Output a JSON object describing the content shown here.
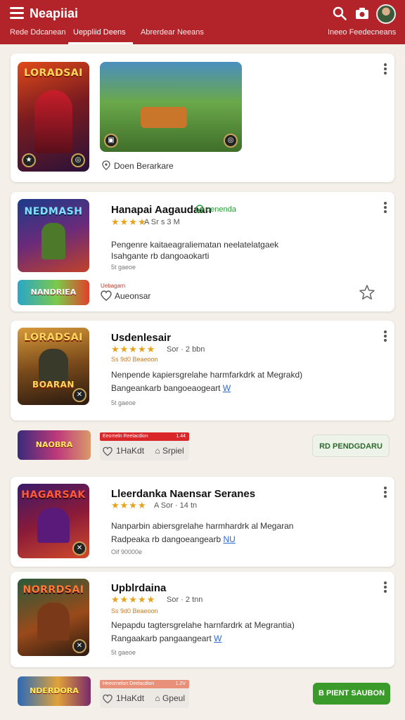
{
  "header": {
    "title": "Neapiiai",
    "tabs": [
      "Rede Ddcanean",
      "Ueppliid Deens",
      "Abrerdear Neeans",
      "Ineeo Feedecneans"
    ],
    "active_tab_index": 1,
    "icons": [
      "menu-icon",
      "search-icon",
      "camera-icon",
      "avatar"
    ]
  },
  "colors": {
    "header": "#b3242a",
    "accent_star": "#e7a21b",
    "green": "#2e9a3a",
    "badge_red": "#d8262a"
  },
  "card1": {
    "thumb_title": "LORADSAI",
    "location": "Doen Berarkare"
  },
  "card2": {
    "thumb_title": "NEDMASH",
    "name": "Hanapai Aagaudaan",
    "genre": "oenenda",
    "rating_text": "★★★★",
    "meta": "A  Sr s  3  M",
    "desc1": "Pengenre kaitaeagraliematan neelatelatgaek",
    "desc2": "Isahgante rb dangoaokarti",
    "small": "5t gaeoe",
    "strip_title": "NANDRIEA",
    "strip_caption": "Uebagarn",
    "wishlist": "Aueonsar"
  },
  "card3": {
    "thumb_title": "LORADSAI",
    "thumb_sub": "BOARAN",
    "name": "Usdenlesair",
    "rating_text": "★★★★★",
    "meta": "Sor  ·  2  bbn",
    "small1": "Ss 9d0 Beaeoon",
    "desc1": "Nenpende kapiersgrelahe harmfarkdrk at Megrakd)",
    "desc2": "Bangeankarb bangoeaogeart",
    "desc2_tag": "W",
    "small2": "5t gaeoe"
  },
  "promo": {
    "strip_title": "NAOBRA",
    "bar_text": "Eeomeln Reelacdion",
    "bar_value": "1.44",
    "stat1": "1HaKdt",
    "stat2": "Srpiel",
    "button": "RD PENDGDARU"
  },
  "card4": {
    "thumb_title": "HAGARSAK",
    "name": "Lleerdanka Naensar Seranes",
    "rating_text": "★★★★",
    "meta": "A  Sor  ·  14  tn",
    "desc1": "Nanparbin abiersgrelahe harmhardrk al Megaran",
    "desc2": "Radpeaka rb dangoeangearb",
    "desc2_tag": "NU",
    "small": "Oif 90000e"
  },
  "card5": {
    "thumb_title": "NORRDSAI",
    "name": "Upblrdaina",
    "rating_text": "★★★★★",
    "meta": "Sor  ·  2  tnn",
    "small1": "Ss 9d0 Beaeoon",
    "desc1": "Nepapdu tagtersgrelahe harnfardrk at Megrantia)",
    "desc2": "Rangaakarb pangaangeart",
    "desc2_tag": "W",
    "small2": "5t gaeoe"
  },
  "bottom": {
    "strip_title": "NDERDORA",
    "bar_text": "Heeornelon Deelacdion",
    "bar_value": "1.2V",
    "stat1": "1HaKdt",
    "stat2": "Gpeul",
    "button": "B PIENT SAUBON"
  }
}
